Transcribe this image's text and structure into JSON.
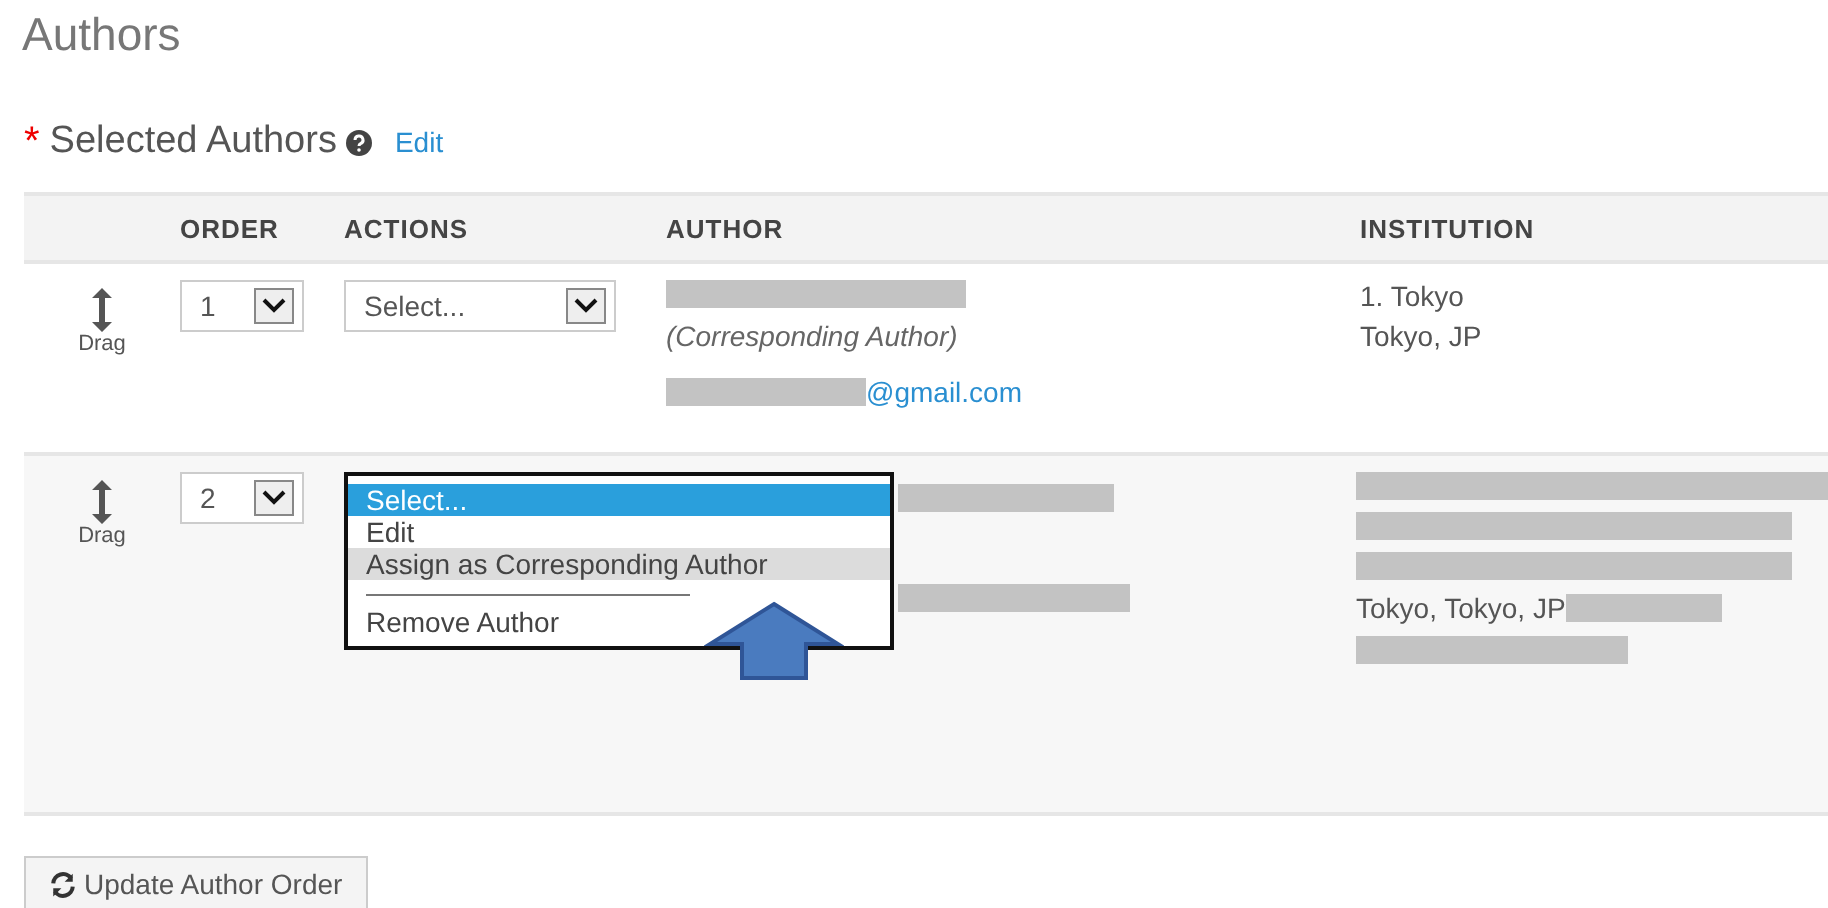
{
  "page_title": "Authors",
  "section": {
    "required_mark": "*",
    "title": "Selected Authors",
    "edit_link": "Edit"
  },
  "table": {
    "columns": [
      "ORDER",
      "ACTIONS",
      "AUTHOR",
      "INSTITUTION"
    ],
    "rows": [
      {
        "drag_label": "Drag",
        "order": "1",
        "menu_open": false,
        "action": "Select...",
        "author_note": "(Corresponding Author)",
        "email_suffix": "@gmail.com",
        "institution": [
          "1. Tokyo",
          "Tokyo, JP"
        ]
      },
      {
        "drag_label": "Drag",
        "order": "2",
        "menu_open": true,
        "menu": [
          {
            "kind": "option",
            "label": "Select...",
            "selected": true,
            "highlighted": false
          },
          {
            "kind": "option",
            "label": "Edit",
            "selected": false,
            "highlighted": false
          },
          {
            "kind": "option",
            "label": "Assign as Corresponding Author",
            "selected": false,
            "highlighted": true
          },
          {
            "kind": "separator"
          },
          {
            "kind": "option",
            "label": "Remove Author",
            "selected": false,
            "highlighted": false
          }
        ],
        "institution": [
          "Tokyo, Tokyo, JP"
        ]
      }
    ]
  },
  "update_button": "Update Author Order"
}
